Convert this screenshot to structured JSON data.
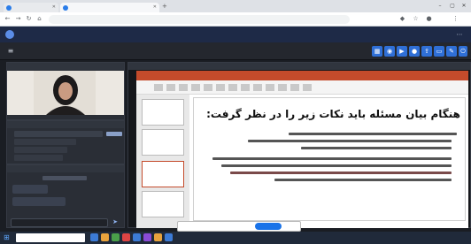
{
  "browser": {
    "tabs": [
      {
        "label": "",
        "active": false,
        "color": "#2b7de9"
      },
      {
        "label": "",
        "active": true,
        "color": "#2b7de9"
      }
    ],
    "url": "",
    "nav_icons": [
      "back-icon",
      "forward-icon",
      "reload-icon"
    ]
  },
  "app": {
    "title": "",
    "tool_icons": [
      "grid-icon",
      "user-icon",
      "video-icon",
      "mic-icon",
      "share-icon",
      "screen-icon",
      "settings-icon",
      "exit-icon"
    ]
  },
  "panels": {
    "webcam": {
      "title": ""
    },
    "users": {
      "title": "",
      "items": [
        "",
        "",
        "",
        ""
      ]
    },
    "chat": {
      "title": ""
    },
    "presentation": {
      "title": ""
    }
  },
  "slide": {
    "title": "هنگام بیان مسئله باید نکات زیر را در نظر گرفت:"
  },
  "notice": {
    "text": "",
    "button": ""
  },
  "taskbar": {
    "search_placeholder": "",
    "colors": [
      "#3c7bd6",
      "#e8a33d",
      "#4a9f4a",
      "#d44",
      "#3c7bd6",
      "#8a4bd6",
      "#e8a33d",
      "#3c7bd6"
    ]
  },
  "colors": {
    "accent": "#2f6fd6",
    "header": "#1e2a47",
    "ppt_red": "#c44b2b"
  }
}
